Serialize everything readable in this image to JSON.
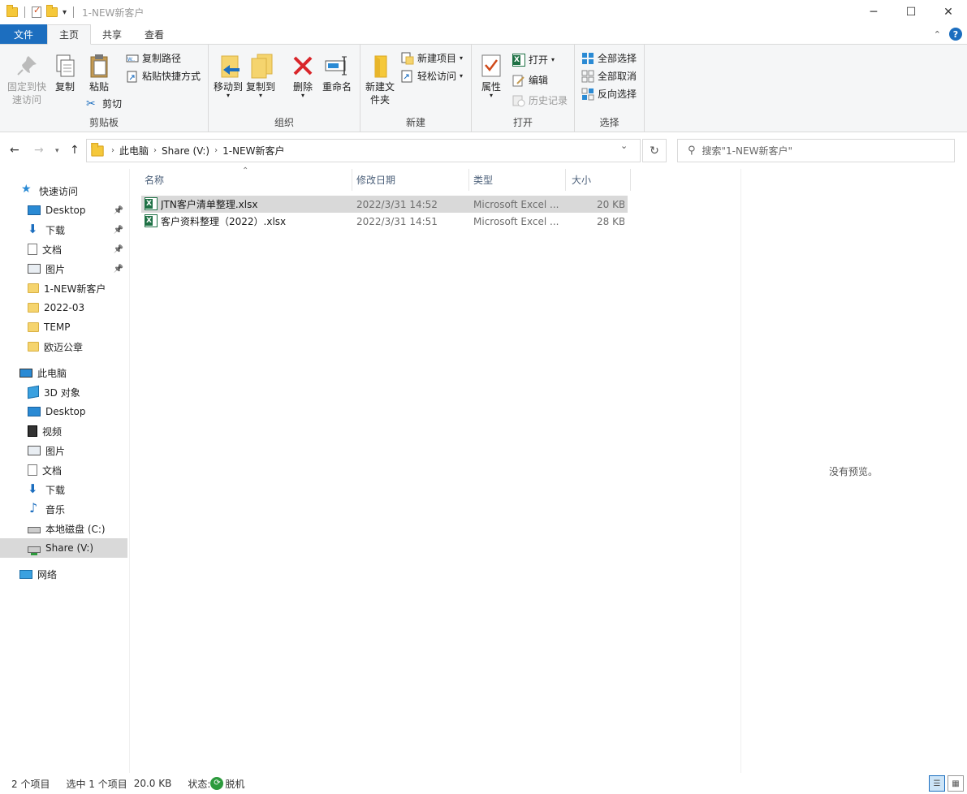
{
  "window": {
    "title": "1-NEW新客户",
    "controls": {
      "minimize": "─",
      "maximize": "☐",
      "close": "✕"
    }
  },
  "ribbon_tabs": [
    "文件",
    "主页",
    "共享",
    "查看"
  ],
  "ribbon": {
    "clipboard": {
      "pin_label": "固定到快速访问",
      "copy_label": "复制",
      "paste_label": "粘贴",
      "copy_path_label": "复制路径",
      "paste_shortcut_label": "粘贴快捷方式",
      "cut_label": "剪切",
      "group_label": "剪贴板"
    },
    "organize": {
      "move_to_label": "移动到",
      "copy_to_label": "复制到",
      "delete_label": "删除",
      "rename_label": "重命名",
      "group_label": "组织"
    },
    "new": {
      "new_folder_label": "新建文件夹",
      "new_item_label": "新建项目",
      "easy_access_label": "轻松访问",
      "group_label": "新建"
    },
    "open": {
      "properties_label": "属性",
      "open_label": "打开",
      "edit_label": "编辑",
      "history_label": "历史记录",
      "group_label": "打开"
    },
    "select": {
      "select_all_label": "全部选择",
      "select_none_label": "全部取消",
      "invert_label": "反向选择",
      "group_label": "选择"
    }
  },
  "address": {
    "crumbs": [
      "此电脑",
      "Share (V:)",
      "1-NEW新客户"
    ],
    "search_placeholder": "搜索\"1-NEW新客户\""
  },
  "nav": {
    "quick_access": "快速访问",
    "quick_items": [
      {
        "label": "Desktop",
        "icon": "desktop-icon",
        "pinned": true
      },
      {
        "label": "下载",
        "icon": "download-icon",
        "pinned": true
      },
      {
        "label": "文档",
        "icon": "document-icon",
        "pinned": true
      },
      {
        "label": "图片",
        "icon": "picture-icon",
        "pinned": true
      },
      {
        "label": "1-NEW新客户",
        "icon": "folder-icon",
        "pinned": false
      },
      {
        "label": "2022-03",
        "icon": "folder-icon",
        "pinned": false
      },
      {
        "label": "TEMP",
        "icon": "folder-icon",
        "pinned": false
      },
      {
        "label": "欧迈公章",
        "icon": "folder-icon",
        "pinned": false
      }
    ],
    "this_pc": "此电脑",
    "pc_items": [
      {
        "label": "3D 对象",
        "icon": "3d-objects-icon"
      },
      {
        "label": "Desktop",
        "icon": "desktop-icon"
      },
      {
        "label": "视频",
        "icon": "video-icon"
      },
      {
        "label": "图片",
        "icon": "picture-icon"
      },
      {
        "label": "文档",
        "icon": "document-icon"
      },
      {
        "label": "下载",
        "icon": "download-icon"
      },
      {
        "label": "音乐",
        "icon": "music-icon"
      },
      {
        "label": "本地磁盘 (C:)",
        "icon": "drive-icon"
      },
      {
        "label": "Share (V:)",
        "icon": "network-drive-icon",
        "selected": true
      }
    ],
    "network": "网络"
  },
  "columns": [
    "名称",
    "修改日期",
    "类型",
    "大小"
  ],
  "files": [
    {
      "name": "JTN客户清单整理.xlsx",
      "modified": "2022/3/31 14:52",
      "type": "Microsoft Excel ...",
      "size": "20 KB",
      "selected": true
    },
    {
      "name": "客户资料整理（2022）.xlsx",
      "modified": "2022/3/31 14:51",
      "type": "Microsoft Excel ...",
      "size": "28 KB",
      "selected": false
    }
  ],
  "preview": {
    "empty_text": "没有预览。"
  },
  "status": {
    "item_count": "2 个项目",
    "selected": "选中 1 个项目",
    "size": "20.0 KB",
    "state_label": "状态:",
    "state_value": "脱机"
  }
}
